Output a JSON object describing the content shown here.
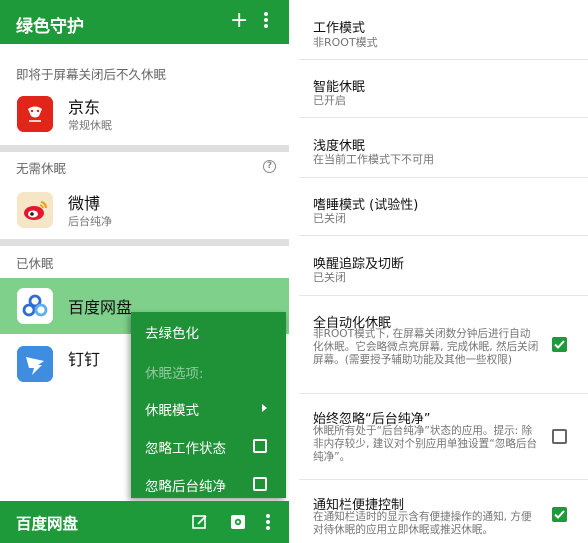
{
  "left_panel": {
    "app_bar": {
      "title": "绿色守护",
      "plus": "+"
    },
    "sections": {
      "pending": {
        "header": "即将于屏幕关闭后不久休眠"
      },
      "no_need": {
        "header": "无需休眠",
        "help": "?"
      },
      "hibernated": {
        "header": "已休眠"
      }
    },
    "apps": [
      {
        "name": "京东",
        "sub": "常规休眠",
        "icon": "jd-icon",
        "color": "#e1251b"
      },
      {
        "name": "微博",
        "sub": "后台纯净",
        "icon": "weibo-icon",
        "color": "#f5e6c8"
      },
      {
        "name": "百度网盘",
        "sub": "",
        "icon": "baidu-netdisk-icon",
        "color": "#ffffff"
      },
      {
        "name": "钉钉",
        "sub": "",
        "icon": "dingtalk-icon",
        "color": "#3f8de0"
      }
    ],
    "context_menu": {
      "items": [
        {
          "label": "去绿色化"
        },
        {
          "label": "休眠选项:"
        },
        {
          "label": "休眠模式"
        },
        {
          "label": "忽略工作状态"
        },
        {
          "label": "忽略后台纯净"
        }
      ]
    },
    "bottom_bar": {
      "title": "百度网盘"
    },
    "colors": {
      "primary": "#1e9a3a",
      "highlight": "#7ed08a",
      "menu": "#1f9136"
    }
  },
  "settings": [
    {
      "title": "工作模式",
      "sub": "非ROOT模式"
    },
    {
      "title": "智能休眠",
      "sub": "已开启"
    },
    {
      "title": "浅度休眠",
      "sub": "在当前工作模式下不可用"
    },
    {
      "title": "嗜睡模式 (试验性)",
      "sub": "已关闭"
    },
    {
      "title": "唤醒追踪及切断",
      "sub": "已关闭"
    },
    {
      "title": "全自动化休眠",
      "desc": "非ROOT模式下, 在屏幕关闭数分钟后进行自动化休眠。它会略微点亮屏幕, 完成休眠, 然后关闭屏幕。(需要授予辅助功能及其他一些权限)",
      "checked": true
    },
    {
      "title": "始终忽略“后台纯净”",
      "desc": "休眠所有处于“后台纯净”状态的应用。提示: 除非内存较少, 建议对个别应用单独设置“忽略后台纯净”。",
      "checked": false
    },
    {
      "title": "通知栏便捷控制",
      "desc": "在通知栏适时的显示含有便捷操作的通知, 方便对待休眠的应用立即休眠或推迟休眠。",
      "checked": true
    }
  ]
}
